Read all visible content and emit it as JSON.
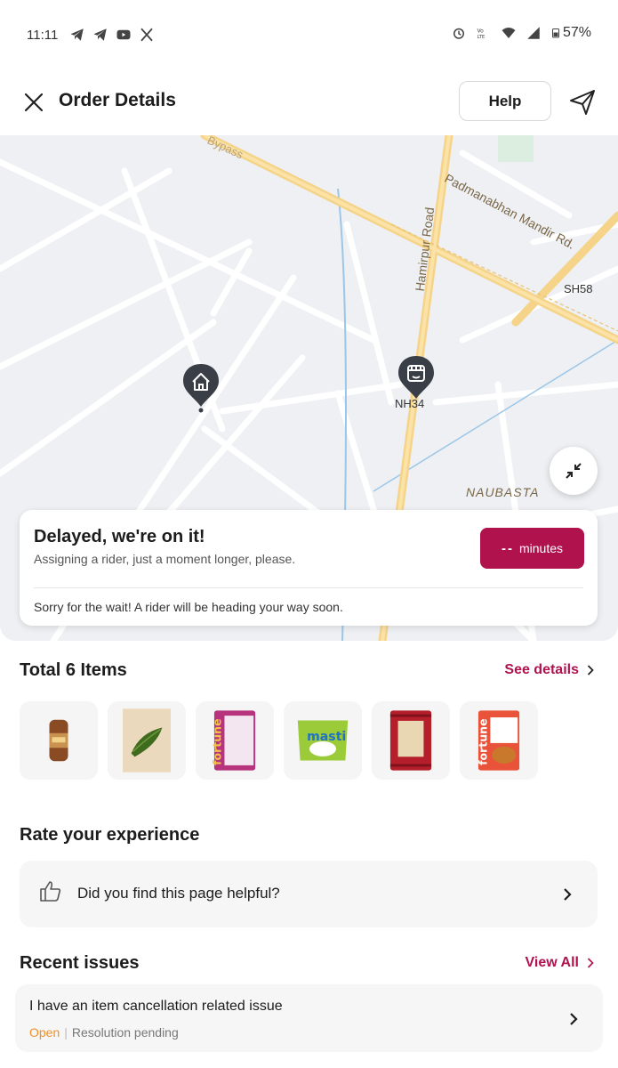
{
  "status_bar": {
    "time": "11:11",
    "app_icons": [
      "telegram-icon",
      "telegram-icon",
      "youtube-icon",
      "x-icon"
    ],
    "battery": "57%"
  },
  "header": {
    "title": "Order Details",
    "help_label": "Help"
  },
  "map": {
    "labels": {
      "bypass": "Bypass",
      "padmanabhan": "Padmanabhan Mandir Rd.",
      "hamirpur": "Hamirpur Road",
      "sh58": "SH58",
      "nh34": "NH34",
      "naubasta": "NAUBASTA"
    }
  },
  "delay_card": {
    "title": "Delayed, we're on it!",
    "subtitle": "Assigning a rider, just a moment longer, please.",
    "eta_value": "--",
    "eta_unit": "minutes",
    "note": "Sorry for the wait! A rider will be heading your way soon."
  },
  "items": {
    "title": "Total 6 Items",
    "see_details": "See details",
    "thumbnails": [
      {
        "name": "bread-product-image"
      },
      {
        "name": "leafy-greens-product-image"
      },
      {
        "name": "fortune-rice-product-image",
        "text": "fortune"
      },
      {
        "name": "masti-product-image",
        "text": "masti"
      },
      {
        "name": "red-pack-product-image"
      },
      {
        "name": "fortune-soya-product-image",
        "text": "fortune"
      }
    ]
  },
  "rate": {
    "title": "Rate your experience",
    "question": "Did you find this page helpful?"
  },
  "issues": {
    "title": "Recent issues",
    "view_all": "View All",
    "list": [
      {
        "title": "I have an item cancellation related issue",
        "state": "Open",
        "status": "Resolution pending"
      }
    ]
  },
  "colors": {
    "accent": "#b0124e",
    "open_status": "#f0902a"
  }
}
